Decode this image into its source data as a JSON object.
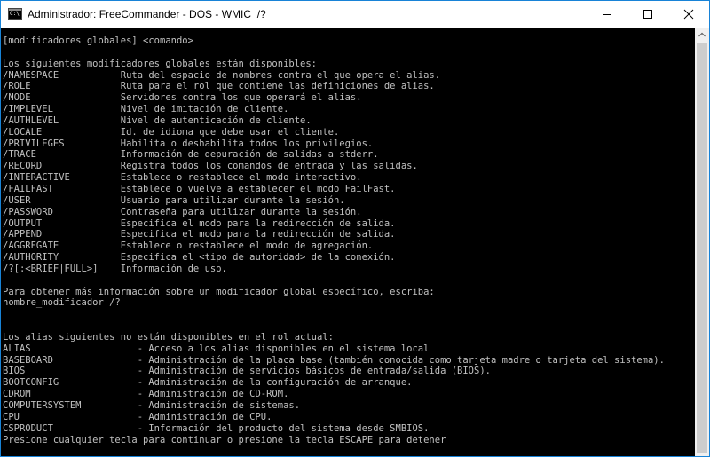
{
  "window": {
    "title": "Administrador: FreeCommander - DOS - WMIC  /?",
    "icon_text": "C:\\",
    "icon_name": "console-app-icon",
    "controls": [
      "minimize-icon",
      "maximize-icon",
      "close-icon"
    ]
  },
  "console": {
    "lines": [
      "[modificadores globales] <comando>",
      "",
      "Los siguientes modificadores globales están disponibles:",
      "/NAMESPACE           Ruta del espacio de nombres contra el que opera el alias.",
      "/ROLE                Ruta para el rol que contiene las definiciones de alias.",
      "/NODE                Servidores contra los que operará el alias.",
      "/IMPLEVEL            Nivel de imitación de cliente.",
      "/AUTHLEVEL           Nivel de autenticación de cliente.",
      "/LOCALE              Id. de idioma que debe usar el cliente.",
      "/PRIVILEGES          Habilita o deshabilita todos los privilegios.",
      "/TRACE               Información de depuración de salidas a stderr.",
      "/RECORD              Registra todos los comandos de entrada y las salidas.",
      "/INTERACTIVE         Establece o restablece el modo interactivo.",
      "/FAILFAST            Establece o vuelve a establecer el modo FailFast.",
      "/USER                Usuario para utilizar durante la sesión.",
      "/PASSWORD            Contraseña para utilizar durante la sesión.",
      "/OUTPUT              Especifica el modo para la redirección de salida.",
      "/APPEND              Especifica el modo para la redirección de salida.",
      "/AGGREGATE           Establece o restablece el modo de agregación.",
      "/AUTHORITY           Especifica el <tipo de autoridad> de la conexión.",
      "/?[:<BRIEF|FULL>]    Información de uso.",
      "",
      "Para obtener más información sobre un modificador global específico, escriba:",
      "nombre_modificador /?",
      "",
      "",
      "Los alias siguientes no están disponibles en el rol actual:",
      "ALIAS                   - Acceso a los alias disponibles en el sistema local",
      "BASEBOARD               - Administración de la placa base (también conocida como tarjeta madre o tarjeta del sistema).",
      "BIOS                    - Administración de servicios básicos de entrada/salida (BIOS).",
      "BOOTCONFIG              - Administración de la configuración de arranque.",
      "CDROM                   - Administración de CD-ROM.",
      "COMPUTERSYSTEM          - Administración de sistemas.",
      "CPU                     - Administración de CPU.",
      "CSPRODUCT               - Información del producto del sistema desde SMBIOS.",
      "Presione cualquier tecla para continuar o presione la tecla ESCAPE para detener"
    ]
  },
  "scrollbar": {
    "up_icon": "chevron-up-icon"
  }
}
